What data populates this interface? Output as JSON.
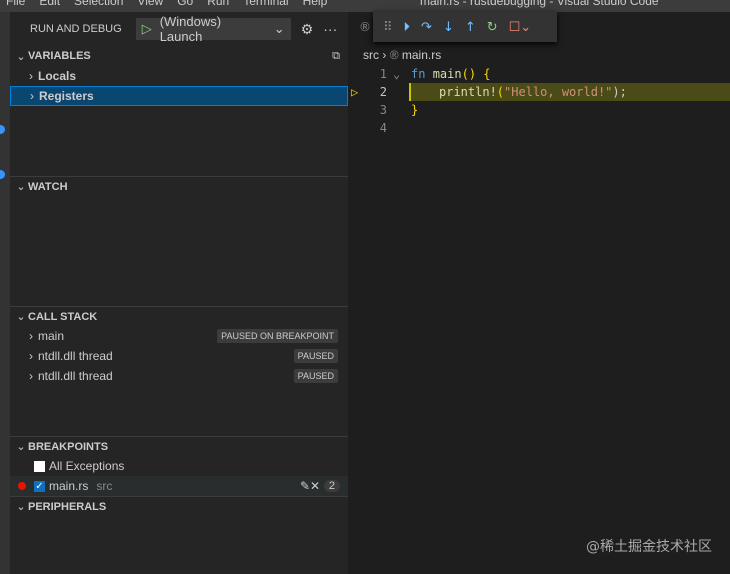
{
  "titlebar": {
    "menu": [
      "File",
      "Edit",
      "Selection",
      "View",
      "Go",
      "Run",
      "Terminal",
      "Help"
    ],
    "title": "main.rs - rustdebugging - Visual Studio Code"
  },
  "sidebar": {
    "header": "RUN AND DEBUG",
    "config": "(Windows) Launch",
    "variables": {
      "title": "VARIABLES",
      "items": [
        "Locals",
        "Registers"
      ]
    },
    "watch": {
      "title": "WATCH"
    },
    "callstack": {
      "title": "CALL STACK",
      "items": [
        {
          "name": "main",
          "status": "PAUSED ON BREAKPOINT"
        },
        {
          "name": "ntdll.dll thread",
          "status": "PAUSED"
        },
        {
          "name": "ntdll.dll thread",
          "status": "PAUSED"
        }
      ]
    },
    "breakpoints": {
      "title": "BREAKPOINTS",
      "all_exceptions": "All Exceptions",
      "file": "main.rs",
      "folder": "src",
      "line": "2"
    },
    "peripherals": {
      "title": "PERIPHERALS"
    }
  },
  "editor": {
    "breadcrumb_folder": "src",
    "breadcrumb_file": "main.rs",
    "lines": [
      "1",
      "2",
      "3",
      "4"
    ],
    "code": {
      "l1_kw": "fn",
      "l1_fn": "main",
      "l1_rest": "() {",
      "l2_fn": "println!",
      "l2_open": "(",
      "l2_str": "\"Hello, world!\"",
      "l2_close": ");",
      "l3": "}"
    }
  },
  "watermark": "@稀土掘金技术社区"
}
